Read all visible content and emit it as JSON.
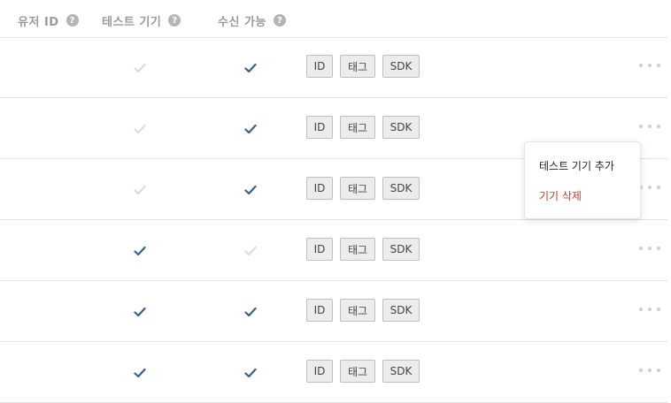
{
  "header": {
    "user_id": "유저 ID",
    "test_device": "테스트 기기",
    "receivable": "수신 가능",
    "help_glyph": "?"
  },
  "colors": {
    "check_active": "#3b5e8c",
    "check_inactive": "#dcdcdc",
    "delete_text": "#c0392b"
  },
  "rows": [
    {
      "test_device": false,
      "receivable": true,
      "buttons": [
        "ID",
        "태그",
        "SDK"
      ]
    },
    {
      "test_device": false,
      "receivable": true,
      "buttons": [
        "ID",
        "태그",
        "SDK"
      ]
    },
    {
      "test_device": false,
      "receivable": true,
      "buttons": [
        "ID",
        "태그",
        "SDK"
      ]
    },
    {
      "test_device": true,
      "receivable": false,
      "buttons": [
        "ID",
        "태그",
        "SDK"
      ]
    },
    {
      "test_device": true,
      "receivable": true,
      "buttons": [
        "ID",
        "태그",
        "SDK"
      ]
    },
    {
      "test_device": true,
      "receivable": true,
      "buttons": [
        "ID",
        "태그",
        "SDK"
      ]
    }
  ],
  "context_menu": {
    "add_test_device": "테스트 기기 추가",
    "delete_device": "기기 삭제"
  }
}
